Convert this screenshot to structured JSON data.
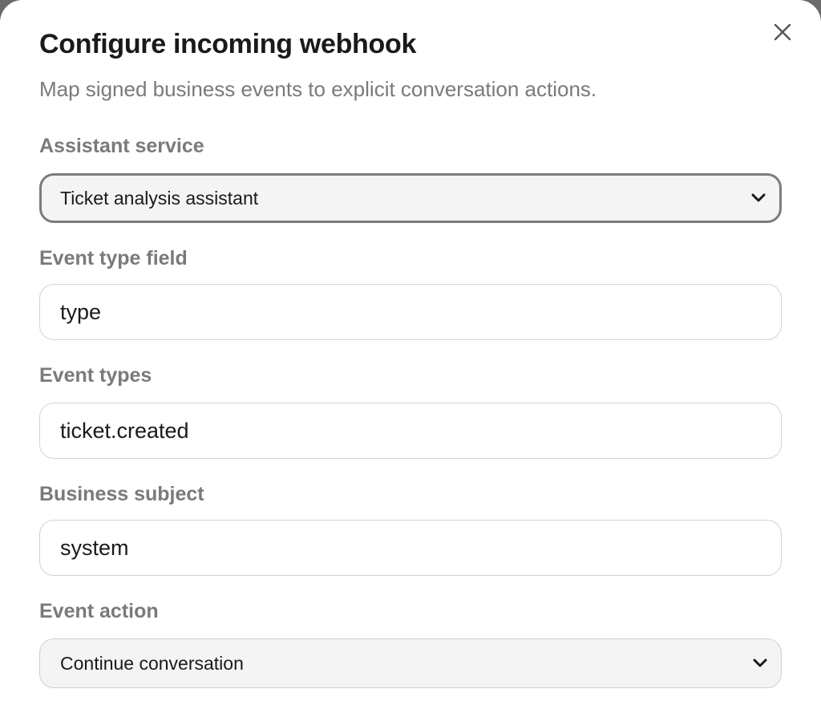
{
  "dialog": {
    "title": "Configure incoming webhook",
    "subtitle": "Map signed business events to explicit conversation actions."
  },
  "fields": {
    "assistant_service": {
      "label": "Assistant service",
      "value": "Ticket analysis assistant"
    },
    "event_type_field": {
      "label": "Event type field",
      "value": "type"
    },
    "event_types": {
      "label": "Event types",
      "value": "ticket.created"
    },
    "business_subject": {
      "label": "Business subject",
      "value": "system"
    },
    "event_action": {
      "label": "Event action",
      "value": "Continue conversation"
    }
  },
  "icons": {
    "close": "close-icon",
    "select_arrow": "chevron-down-icon"
  }
}
